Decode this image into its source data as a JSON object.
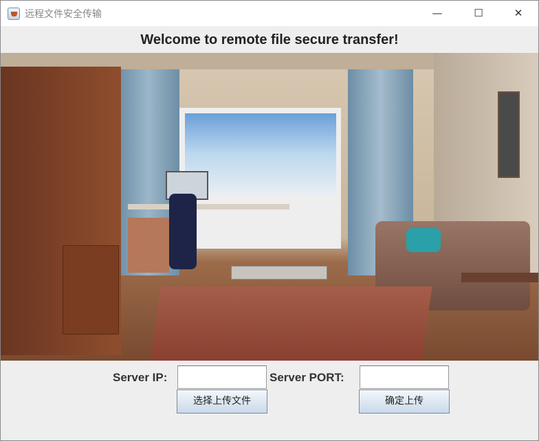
{
  "window": {
    "title": "远程文件安全传输",
    "minimize": "—",
    "maximize": "☐",
    "close": "✕"
  },
  "heading": "Welcome to remote file secure transfer!",
  "form": {
    "server_ip_label": "Server IP:",
    "server_ip_value": "",
    "server_port_label": "Server PORT:",
    "server_port_value": "",
    "choose_file_button": "选择上传文件",
    "confirm_upload_button": "确定上传"
  }
}
